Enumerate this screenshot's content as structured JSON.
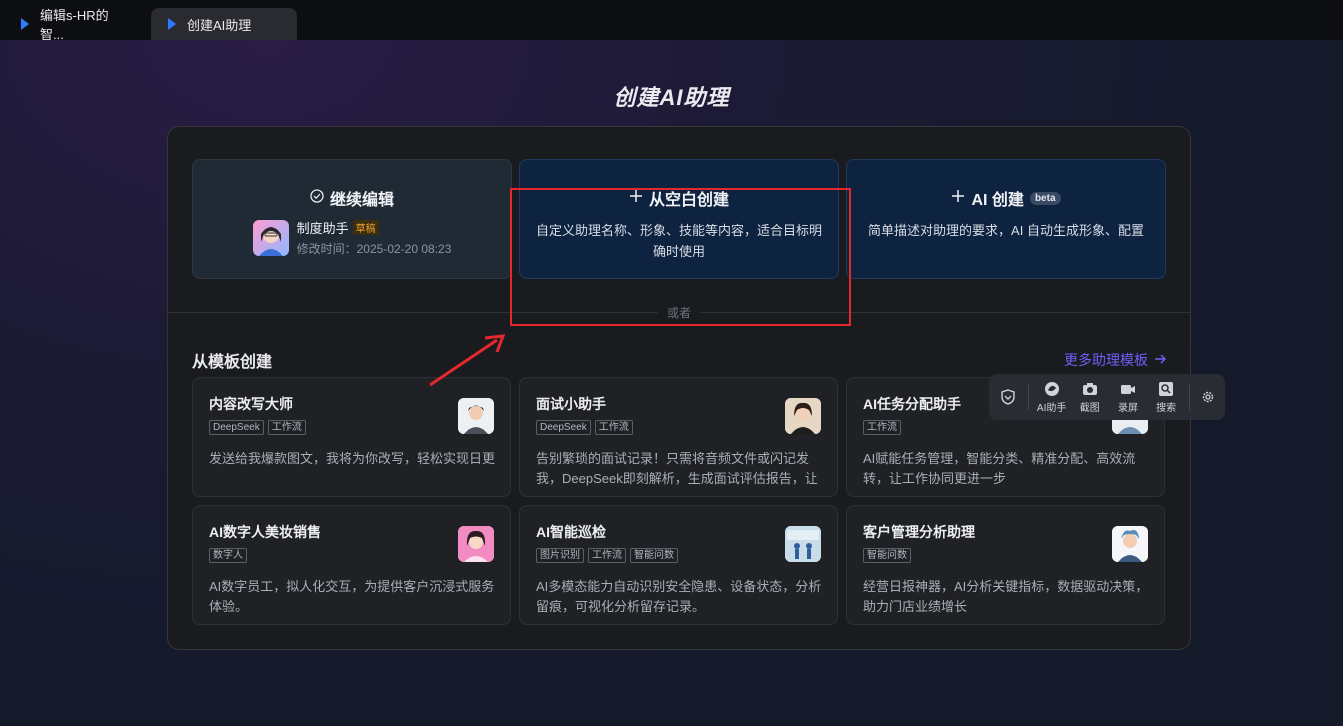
{
  "tabs": [
    {
      "label": "编辑s-HR的智..."
    },
    {
      "label": "创建AI助理"
    }
  ],
  "page": {
    "title": "创建AI助理"
  },
  "options": {
    "continue": {
      "title": "继续编辑",
      "draft_name": "制度助手",
      "draft_badge": "草稿",
      "modified": "修改时间：2025-02-20 08:23"
    },
    "blank": {
      "title": "从空白创建",
      "desc": "自定义助理名称、形象、技能等内容，适合目标明确时使用"
    },
    "ai": {
      "title": "AI 创建",
      "badge": "beta",
      "desc": "简单描述对助理的要求，AI 自动生成形象、配置"
    }
  },
  "divider_label": "或者",
  "templates": {
    "section_title": "从模板创建",
    "more_label": "更多助理模板",
    "cards": [
      {
        "title": "内容改写大师",
        "tags": [
          "DeepSeek",
          "工作流"
        ],
        "desc": "发送给我爆款图文，我将为你改写，轻松实现日更"
      },
      {
        "title": "面试小助手",
        "tags": [
          "DeepSeek",
          "工作流"
        ],
        "desc": "告别繁琐的面试记录！只需将音频文件或闪记发我，DeepSeek即刻解析，生成面试评估报告，让决策更..."
      },
      {
        "title": "AI任务分配助手",
        "tags": [
          "工作流"
        ],
        "desc": "AI赋能任务管理，智能分类、精准分配、高效流转，让工作协同更进一步"
      },
      {
        "title": "AI数字人美妆销售",
        "tags": [
          "数字人"
        ],
        "desc": "AI数字员工，拟人化交互，为提供客户沉浸式服务体验。"
      },
      {
        "title": "AI智能巡检",
        "tags": [
          "图片识别",
          "工作流",
          "智能问数"
        ],
        "desc": "AI多模态能力自动识别安全隐患、设备状态，分析留痕，可视化分析留存记录。"
      },
      {
        "title": "客户管理分析助理",
        "tags": [
          "智能问数"
        ],
        "desc": "经营日报神器，AI分析关键指标，数据驱动决策，助力门店业绩增长"
      }
    ]
  },
  "float_toolbar": {
    "items": [
      {
        "label": "AI助手",
        "icon": "ai-assistant-icon"
      },
      {
        "label": "截图",
        "icon": "camera-icon"
      },
      {
        "label": "录屏",
        "icon": "video-icon"
      },
      {
        "label": "搜索",
        "icon": "search-icon"
      }
    ]
  }
}
